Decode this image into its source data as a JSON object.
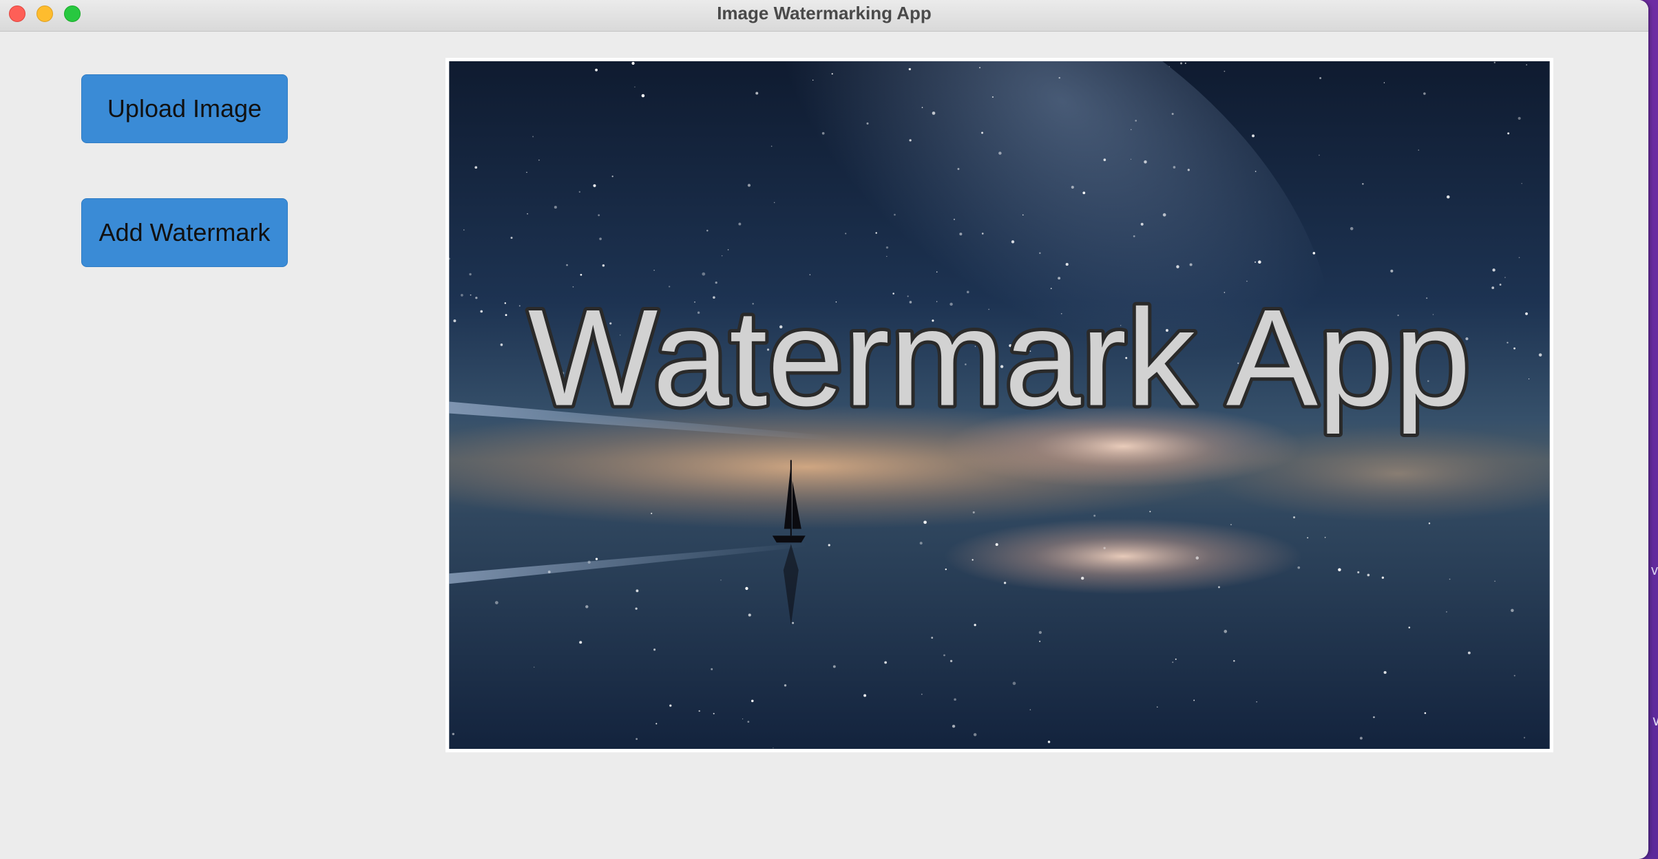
{
  "window": {
    "title": "Image Watermarking App"
  },
  "sidebar": {
    "upload_label": "Upload Image",
    "watermark_label": "Add Watermark"
  },
  "image": {
    "watermark_text": "Watermark App",
    "watermark_fill": "#d2d2d2",
    "watermark_stroke": "#2a2a2a"
  },
  "colors": {
    "button_bg": "#3a8bd6",
    "window_bg": "#ececec",
    "close": "#fe5f57",
    "minimize": "#febc2e",
    "zoom": "#28c840"
  }
}
